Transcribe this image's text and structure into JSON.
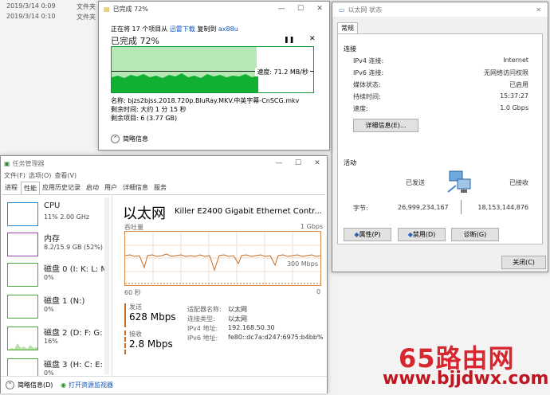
{
  "explorer": {
    "rows": [
      {
        "date": "2019/3/14 0:09",
        "type": "文件夹"
      },
      {
        "date": "2019/3/14 0:10",
        "type": "文件夹"
      }
    ]
  },
  "copy": {
    "title": "已完成 72%",
    "line_pre": "正在将 17 个项目从",
    "source": "迅雷下载",
    "line_mid": "复制到",
    "dest": "ax88u",
    "big": "已完成 72%",
    "percent": 72,
    "speed": "速度: 71.2 MB/秒",
    "name_label": "名称: bjzs2bjss.2018.720p.BluRay.MKV.中英字幕-CnSCG.mkv",
    "time_left": "剩余时间: 大约 1 分 15 秒",
    "items_left": "剩余项目: 6 (3.77 GB)",
    "less": "简略信息"
  },
  "status": {
    "title": "以太网 状态",
    "tab": "常规",
    "conn_h": "连接",
    "rows": [
      {
        "k": "IPv4 连接:",
        "v": "Internet"
      },
      {
        "k": "IPv6 连接:",
        "v": "无网络访问权限"
      },
      {
        "k": "媒体状态:",
        "v": "已启用"
      },
      {
        "k": "持续时间:",
        "v": "15:37:27"
      },
      {
        "k": "速度:",
        "v": "1.0 Gbps"
      }
    ],
    "details_btn": "详细信息(E)...",
    "activity_h": "活动",
    "sent": "已发送",
    "recv": "已接收",
    "bytes_label": "字节:",
    "bytes_sent": "26,999,234,167",
    "bytes_recv": "18,153,144,876",
    "props_btn": "属性(P)",
    "disable_btn": "禁用(D)",
    "diag_btn": "诊断(G)",
    "close_btn": "关闭(C)"
  },
  "tm": {
    "title": "任务管理器",
    "menu": [
      "文件(F)",
      "选项(O)",
      "查看(V)"
    ],
    "tabs": [
      "进程",
      "性能",
      "应用历史记录",
      "启动",
      "用户",
      "详细信息",
      "服务"
    ],
    "side": [
      {
        "t": "CPU",
        "s": "11% 2.00 GHz",
        "c": "#1c8ecf"
      },
      {
        "t": "内存",
        "s": "8.2/15.9 GB (52%)",
        "c": "#9b3fb0"
      },
      {
        "t": "磁盘 0 (I: K: L: M",
        "s": "0%",
        "c": "#4ba634"
      },
      {
        "t": "磁盘 1 (N:)",
        "s": "0%",
        "c": "#4ba634"
      },
      {
        "t": "磁盘 2 (D: F: G:",
        "s": "16%",
        "c": "#4ba634"
      },
      {
        "t": "磁盘 3 (H: C: E:",
        "s": "0%",
        "c": "#4ba634"
      }
    ],
    "eth_title": "以太网",
    "adapter": "Killer E2400 Gigabit Ethernet Contr...",
    "throughput": "吞吐量",
    "max": "1 Gbps",
    "mid": "300 Mbps",
    "sec": "60 秒",
    "zero": "0",
    "send_label": "发送",
    "send_val": "628 Mbps",
    "recv_label": "接收",
    "recv_val": "2.8 Mbps",
    "info": [
      {
        "k": "适配器名称:",
        "v": "以太网"
      },
      {
        "k": "连接类型:",
        "v": "以太网"
      },
      {
        "k": "IPv4 地址:",
        "v": "192.168.50.30"
      },
      {
        "k": "IPv6 地址:",
        "v": "fe80::dc7a:d247:6975:b4bb%..."
      }
    ],
    "brief": "简略信息(D)",
    "monitor": "打开资源监视器"
  },
  "watermark": {
    "big": "65路由网",
    "small": "www.bjjdwx.com"
  }
}
